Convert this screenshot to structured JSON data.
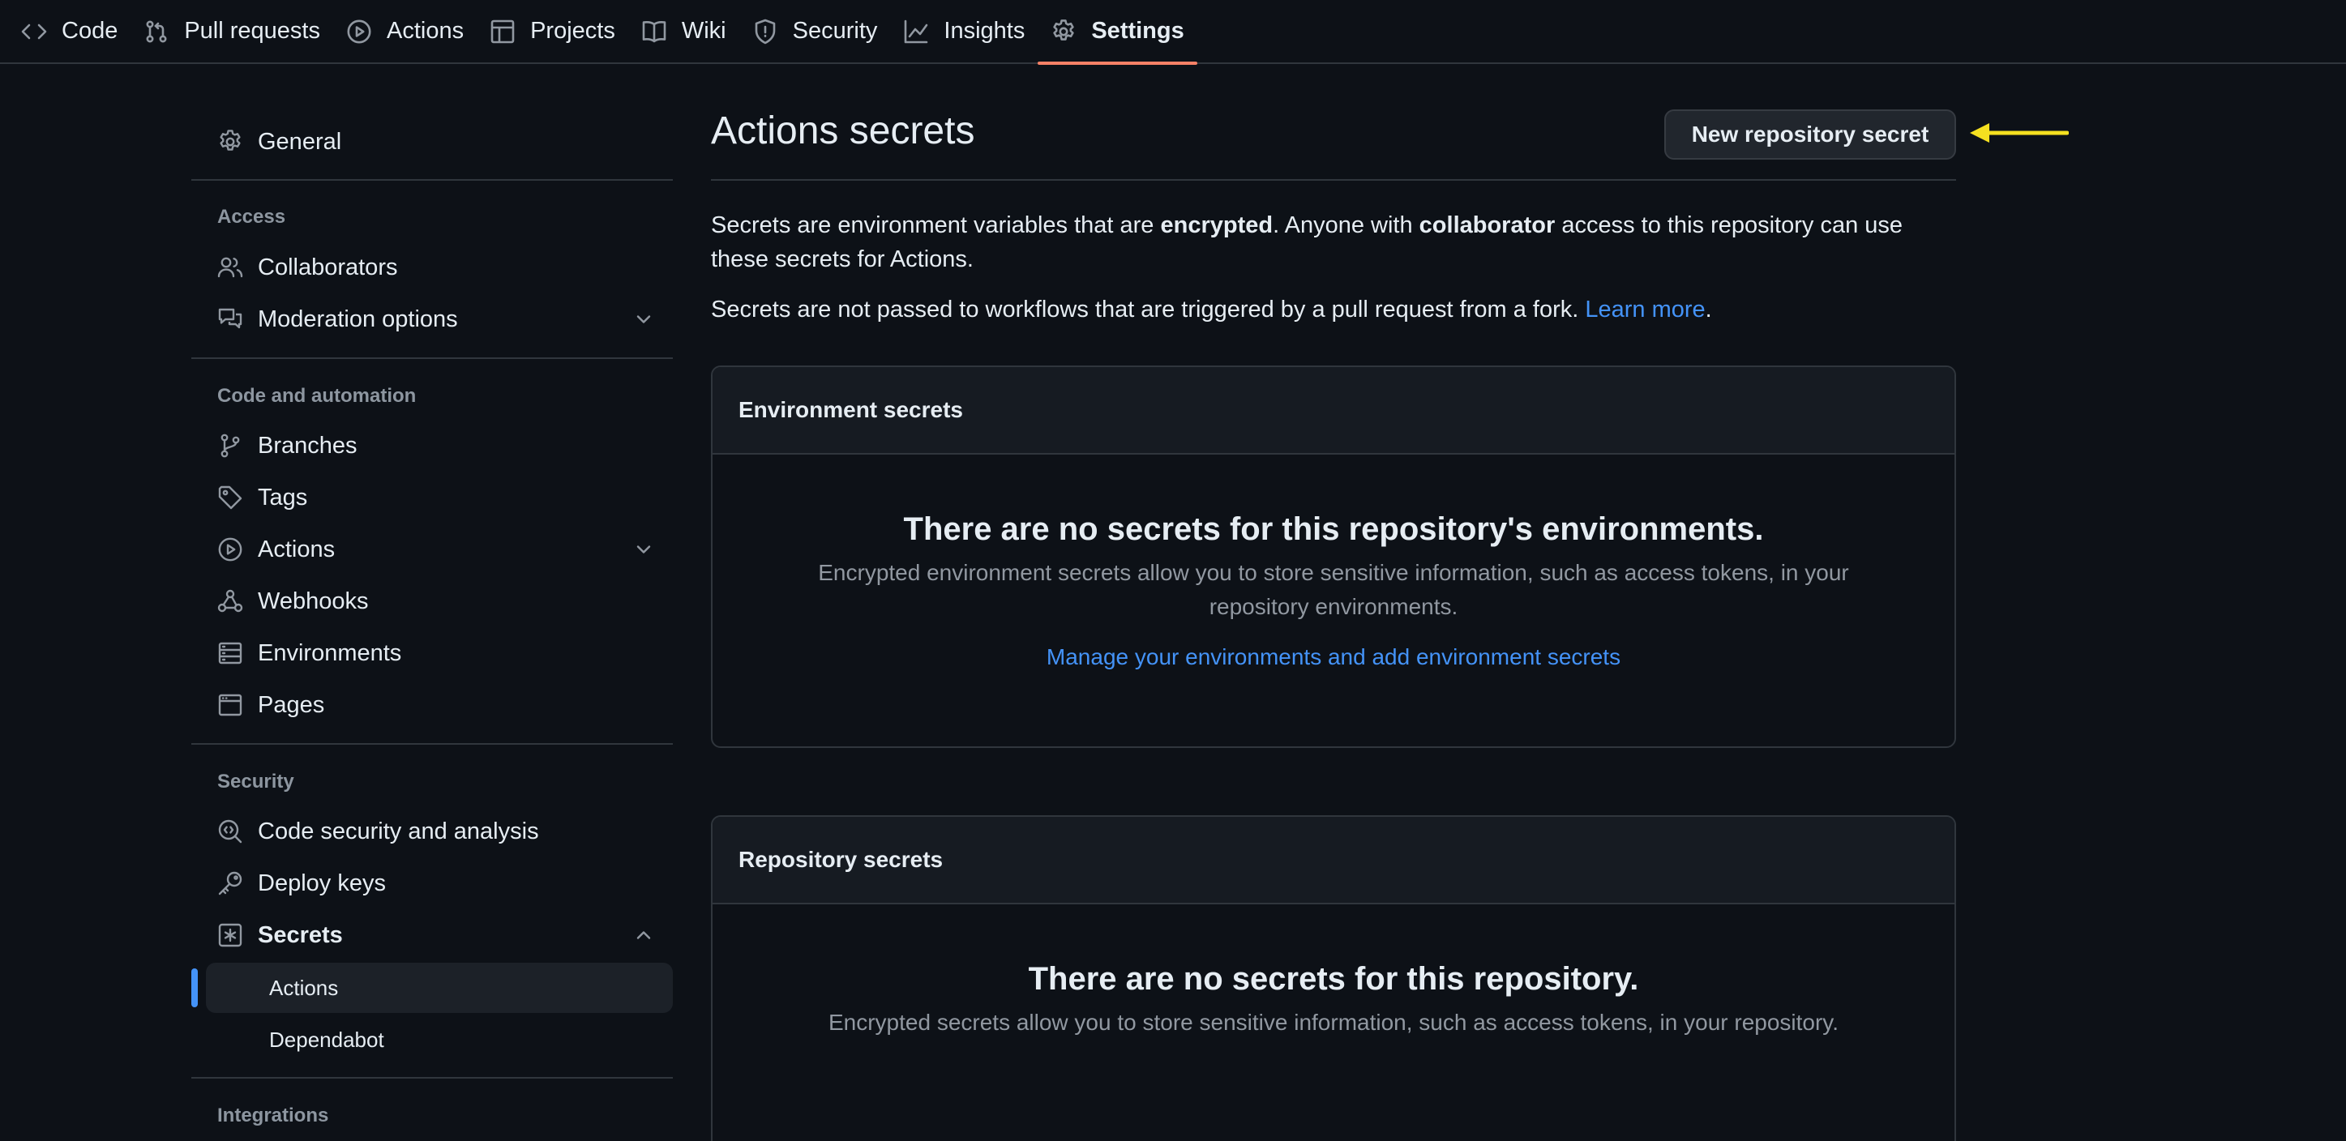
{
  "topnav": {
    "tabs": [
      {
        "label": "Code",
        "icon": "code-icon"
      },
      {
        "label": "Pull requests",
        "icon": "git-pull-request-icon"
      },
      {
        "label": "Actions",
        "icon": "play-icon"
      },
      {
        "label": "Projects",
        "icon": "table-icon"
      },
      {
        "label": "Wiki",
        "icon": "book-icon"
      },
      {
        "label": "Security",
        "icon": "shield-icon"
      },
      {
        "label": "Insights",
        "icon": "graph-icon"
      },
      {
        "label": "Settings",
        "icon": "gear-icon",
        "active": true
      }
    ]
  },
  "sidebar": {
    "general": "General",
    "access_heading": "Access",
    "collaborators": "Collaborators",
    "moderation": "Moderation options",
    "code_heading": "Code and automation",
    "branches": "Branches",
    "tags": "Tags",
    "actions": "Actions",
    "webhooks": "Webhooks",
    "environments": "Environments",
    "pages": "Pages",
    "security_heading": "Security",
    "code_security": "Code security and analysis",
    "deploy_keys": "Deploy keys",
    "secrets": "Secrets",
    "secrets_actions": "Actions",
    "secrets_dependabot": "Dependabot",
    "integrations_heading": "Integrations"
  },
  "main": {
    "title": "Actions secrets",
    "new_secret_button": "New repository secret",
    "intro": {
      "p1_a": "Secrets are environment variables that are ",
      "p1_b": "encrypted",
      "p1_c": ". Anyone with ",
      "p1_d": "collaborator",
      "p1_e": " access to this repository can use",
      "p1_f": "these secrets for Actions.",
      "p2_a": "Secrets are not passed to workflows that are triggered by a pull request from a fork. ",
      "p2_link": "Learn more",
      "p2_end": "."
    },
    "env_box": {
      "header": "Environment secrets",
      "blank_title": "There are no secrets for this repository's environments.",
      "blank_desc_1": "Encrypted environment secrets allow you to store sensitive information, such as access tokens, in your",
      "blank_desc_2": "repository environments.",
      "link": "Manage your environments and add environment secrets"
    },
    "repo_box": {
      "header": "Repository secrets",
      "blank_title": "There are no secrets for this repository.",
      "blank_desc": "Encrypted secrets allow you to store sensitive information, such as access tokens, in your repository."
    }
  },
  "colors": {
    "background": "#0d1117",
    "accent_link": "#4493f8",
    "active_tab_underline": "#f78166",
    "annotation_arrow": "#f5e020"
  }
}
